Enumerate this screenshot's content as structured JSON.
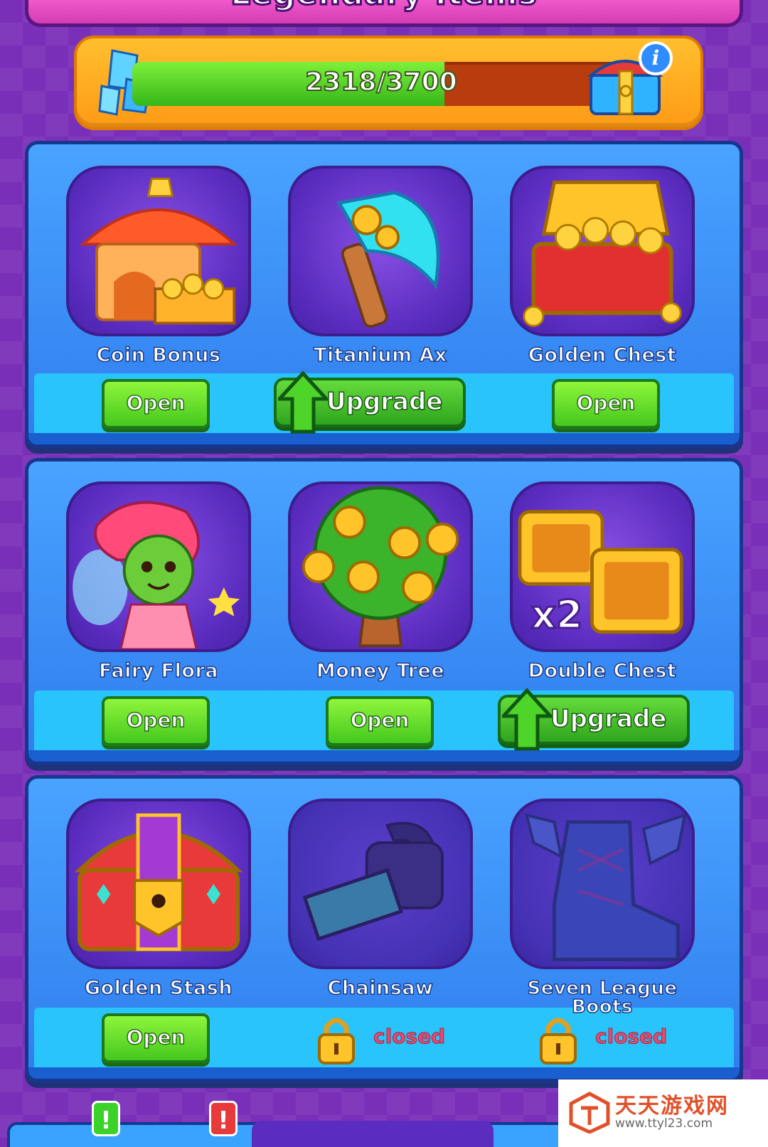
{
  "header": {
    "title": "Legendary Items"
  },
  "progress": {
    "text": "2318/3700",
    "current": 2318,
    "total": 3700,
    "fill_color": "#4fd42a",
    "track_color": "#b83c0e"
  },
  "rows": [
    {
      "items": [
        {
          "name": "Coin Bonus",
          "icon": "coin-bonus-icon",
          "action": "Open"
        },
        {
          "name": "Titanium Ax",
          "icon": "titanium-ax-icon",
          "action": "Upgrade"
        },
        {
          "name": "Golden Chest",
          "icon": "golden-chest-icon",
          "action": "Open"
        }
      ]
    },
    {
      "items": [
        {
          "name": "Fairy Flora",
          "icon": "fairy-icon",
          "action": "Open"
        },
        {
          "name": "Money Tree",
          "icon": "money-tree-icon",
          "action": "Open"
        },
        {
          "name": "Double Chest",
          "icon": "double-chest-icon",
          "action": "Upgrade",
          "badge": "x2"
        }
      ]
    },
    {
      "items": [
        {
          "name": "Golden Stash",
          "icon": "golden-stash-icon",
          "action": "Open"
        },
        {
          "name": "Chainsaw",
          "icon": "chainsaw-icon",
          "action": "closed"
        },
        {
          "name": "Seven League Boots",
          "icon": "winged-boots-icon",
          "action": "closed"
        }
      ]
    }
  ],
  "buttons": {
    "open_label": "Open",
    "upgrade_label": "Upgrade",
    "closed_label": "closed"
  },
  "bottom_nav": {
    "badge_1": "!",
    "badge_2": "!"
  },
  "watermark": {
    "title": "天天游戏网",
    "url": "www.ttyl23.com"
  },
  "colors": {
    "background": "#7a2fb8",
    "row_blue": "#3a8ff7",
    "button_green": "#5ad92e",
    "closed_red": "#ff3d5e"
  }
}
